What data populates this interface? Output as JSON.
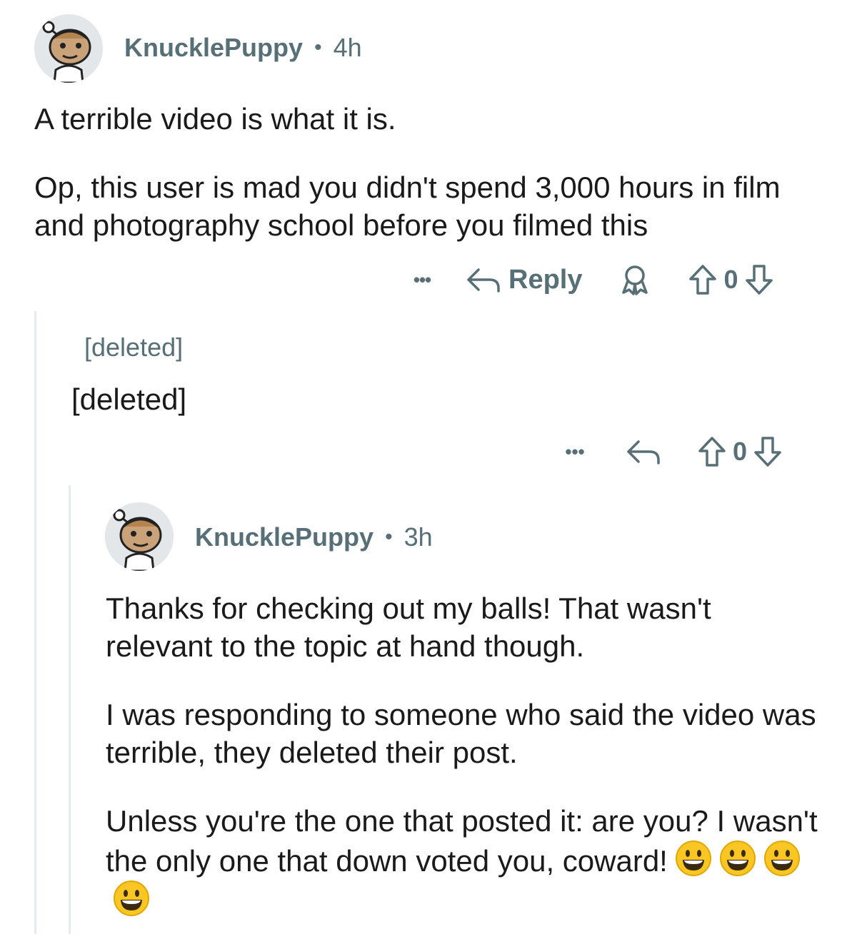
{
  "comment1": {
    "username": "KnucklePuppy",
    "separator": "•",
    "age": "4h",
    "paragraphs": [
      "A terrible video is what it is.",
      "Op, this user is mad you didn't spend 3,000 hours in film and photography school before you filmed this"
    ],
    "more_label": "•••",
    "reply_label": "Reply",
    "vote_count": "0"
  },
  "comment2": {
    "meta": "[deleted]",
    "body": "[deleted]",
    "more_label": "•••",
    "vote_count": "0"
  },
  "comment3": {
    "username": "KnucklePuppy",
    "separator": "•",
    "age": "3h",
    "paragraphs": [
      "Thanks for checking out my balls! That wasn't relevant to the topic at hand though.",
      "I was responding to someone who said the video was terrible, they deleted their post.",
      "Unless you're the one that posted it: are you? I wasn't the only one that down voted you, coward!"
    ],
    "emojis": [
      "grinning-face",
      "grinning-face",
      "grinning-face",
      "grinning-face"
    ]
  },
  "colors": {
    "meta_gray": "#576f76",
    "thread_line": "#e5ebee",
    "text": "#1a1a1b",
    "emoji_yellow": "#f9c623"
  }
}
